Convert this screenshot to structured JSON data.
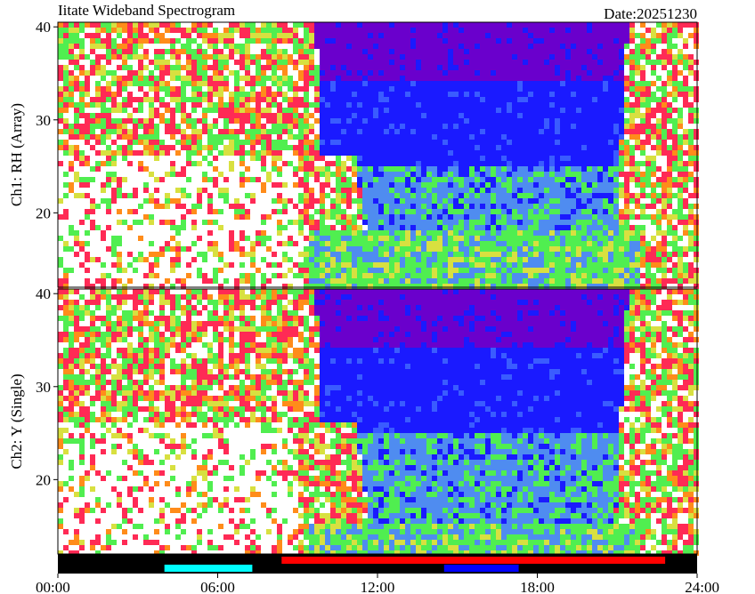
{
  "header": {
    "title": "Iitate Wideband Spectrogram",
    "date_label": "Date:20251230"
  },
  "chart_data": [
    {
      "type": "heatmap",
      "panel": "top",
      "ylabel": "Ch1: RH (Array)",
      "ylim": [
        12,
        40.5
      ],
      "yticks": [
        20,
        30,
        40
      ],
      "xlim": [
        0,
        24
      ],
      "noise_minimum_band": {
        "x_start": 9.5,
        "x_end": 21.8
      },
      "noise_floor_y": 18
    },
    {
      "type": "heatmap",
      "panel": "bottom",
      "ylabel": "Ch2: Y (Single)",
      "ylim": [
        12,
        40.5
      ],
      "yticks": [
        20,
        30,
        40
      ],
      "xlim": [
        0,
        24
      ],
      "noise_minimum_band": {
        "x_start": 9.5,
        "x_end": 21.8
      },
      "noise_floor_y": 15
    }
  ],
  "x_axis": {
    "range_hours": [
      0,
      24
    ],
    "ticks": [
      {
        "hour": 0,
        "label": "00:00"
      },
      {
        "hour": 6,
        "label": "06:00"
      },
      {
        "hour": 12,
        "label": "12:00"
      },
      {
        "hour": 18,
        "label": "18:00"
      },
      {
        "hour": 24,
        "label": "24:00"
      }
    ]
  },
  "status_bar": {
    "background": "#000000",
    "segments": [
      {
        "start": 4.0,
        "end": 7.3,
        "color": "#00ffff",
        "row": "bottom"
      },
      {
        "start": 8.4,
        "end": 22.8,
        "color": "#ff0000",
        "row": "top"
      },
      {
        "start": 14.5,
        "end": 17.3,
        "color": "#0000ff",
        "row": "bottom"
      }
    ]
  },
  "colors": {
    "white": "#ffffff",
    "magenta_red": "#ff2a55",
    "orange": "#ff8c1a",
    "yellow": "#d8e040",
    "green": "#50ee50",
    "blue": "#1a1aff",
    "purple": "#6a00cc"
  }
}
